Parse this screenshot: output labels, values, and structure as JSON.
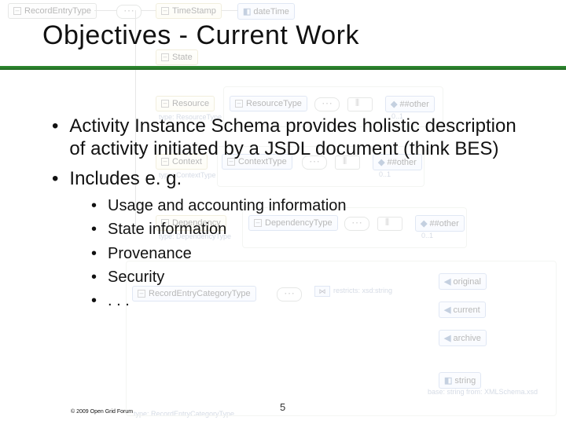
{
  "slide": {
    "title": "Objectives - Current Work",
    "bullets": [
      "Activity Instance Schema provides holistic description of activity initiated by a JSDL document (think BES)",
      "Includes e. g."
    ],
    "subbullets": [
      "Usage and accounting information",
      "State information",
      "Provenance",
      "Security",
      ". . ."
    ],
    "page_number": "5",
    "footer": "© 2009 Open Grid Forum"
  },
  "bg": {
    "boxes": {
      "record_entry": "RecordEntryType",
      "timestamp": "TimeStamp",
      "datetime": "dateTime",
      "state": "State",
      "resource": "Resource",
      "resource_type": "ResourceType",
      "other1": "##other",
      "context": "Context",
      "context_type": "ContextType",
      "other2": "##other",
      "dependency": "Dependency",
      "dependency_type": "DependencyType",
      "other3": "##other",
      "rec_cat": "RecordEntryCategoryType",
      "restricts": "restricts: xsd:string",
      "original": "original",
      "current": "current",
      "archive": "archive",
      "string": "string",
      "type_resource": "type: ResourceType",
      "type_context": "type: ContextType",
      "type_dependency": "type: DependencyType",
      "type_reccat": "type: RecordEntryCategoryType",
      "base": "base: string from: XMLSchema.xsd",
      "card": "0..1"
    }
  }
}
